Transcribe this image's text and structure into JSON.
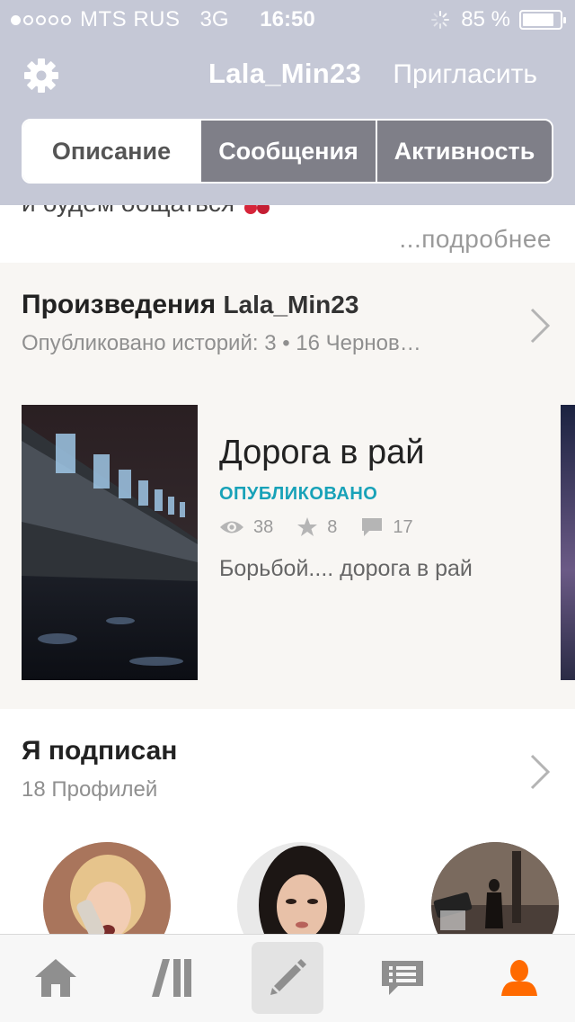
{
  "status_bar": {
    "carrier": "MTS RUS",
    "network": "3G",
    "time": "16:50",
    "battery": "85 %",
    "battery_level": 0.85,
    "signal_dots_filled": 1
  },
  "header": {
    "username": "Lala_Min23",
    "invite_label": "Пригласить",
    "settings_icon": "gear-icon",
    "bg_color": "#c5c8d6"
  },
  "tabs": [
    {
      "label": "Описание",
      "active": true
    },
    {
      "label": "Сообщения",
      "active": false
    },
    {
      "label": "Активность",
      "active": false
    }
  ],
  "description": {
    "text_fragment": "и будем общаться",
    "more_label": "...подробнее"
  },
  "works": {
    "title_prefix": "Произведения",
    "title_user": "Lala_Min23",
    "subtitle": "Опубликовано историй: 3 • 16 Чернов…",
    "story": {
      "title": "Дорога в рай",
      "status": "ОПУБЛИКОВАНО",
      "status_color": "#18a2b8",
      "views": "38",
      "votes": "8",
      "comments": "17",
      "description": "Борьбой.... дорога в рай"
    }
  },
  "following": {
    "title": "Я подписан",
    "subtitle": "18 Профилей"
  },
  "bottom_nav": {
    "items": [
      {
        "icon": "home-icon",
        "active": false
      },
      {
        "icon": "library-icon",
        "active": false
      },
      {
        "icon": "pencil-icon",
        "active": false
      },
      {
        "icon": "messages-icon",
        "active": false
      },
      {
        "icon": "profile-icon",
        "active": true
      }
    ],
    "active_color": "#ff6a00"
  }
}
